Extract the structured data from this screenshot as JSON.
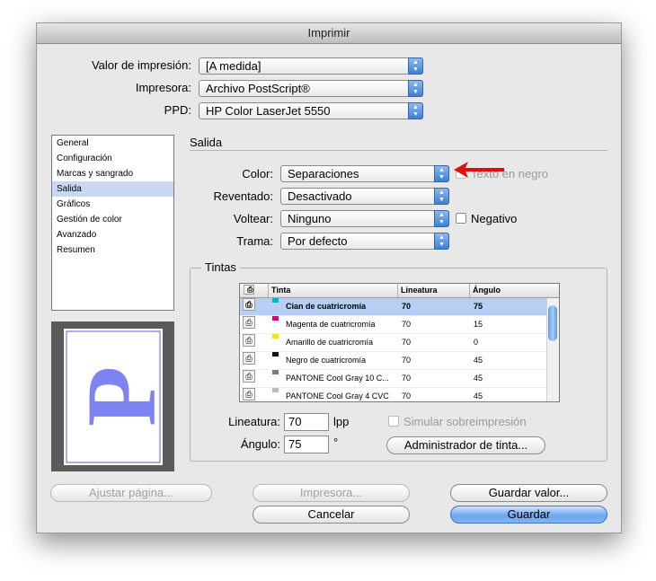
{
  "window": {
    "title": "Imprimir"
  },
  "top": {
    "preset_label": "Valor de impresión:",
    "preset_value": "[A medida]",
    "printer_label": "Impresora:",
    "printer_value": "Archivo PostScript®",
    "ppd_label": "PPD:",
    "ppd_value": "HP Color LaserJet 5550"
  },
  "sidebar": {
    "items": [
      "General",
      "Configuración",
      "Marcas y sangrado",
      "Salida",
      "Gráficos",
      "Gestión de color",
      "Avanzado",
      "Resumen"
    ],
    "selected": "Salida"
  },
  "preview": {
    "letter": "P"
  },
  "output": {
    "section_title": "Salida",
    "color_label": "Color:",
    "color_value": "Separaciones",
    "text_black_label": "Texto en negro",
    "trapping_label": "Reventado:",
    "trapping_value": "Desactivado",
    "flip_label": "Voltear:",
    "flip_value": "Ninguno",
    "negative_label": "Negativo",
    "screening_label": "Trama:",
    "screening_value": "Por defecto"
  },
  "inks": {
    "group_title": "Tintas",
    "columns": [
      "Tinta",
      "Lineatura",
      "Ángulo"
    ],
    "rows": [
      {
        "name": "Cian de cuatricromía",
        "freq": "70",
        "angle": "75",
        "swatch": "#00b7c8"
      },
      {
        "name": "Magenta de cuatricromía",
        "freq": "70",
        "angle": "15",
        "swatch": "#e2007a"
      },
      {
        "name": "Amarillo de cuatricromía",
        "freq": "70",
        "angle": "0",
        "swatch": "#f3e600"
      },
      {
        "name": "Negro de cuatricromía",
        "freq": "70",
        "angle": "45",
        "swatch": "#111111"
      },
      {
        "name": "PANTONE Cool Gray 10 C...",
        "freq": "70",
        "angle": "45",
        "swatch": "#7c7c7c"
      },
      {
        "name": "PANTONE Cool Gray 4 CVC",
        "freq": "70",
        "angle": "45",
        "swatch": "#bdbdbd"
      }
    ],
    "freq_label": "Lineatura:",
    "freq_value": "70",
    "freq_unit": "lpp",
    "angle_label": "Ángulo:",
    "angle_value": "75",
    "angle_unit": "°",
    "simulate_label": "Simular sobreimpresión",
    "ink_manager_button": "Administrador de tinta..."
  },
  "buttons": {
    "fit_page": "Ajustar página...",
    "printer": "Impresora...",
    "save_preset": "Guardar valor...",
    "cancel": "Cancelar",
    "save": "Guardar"
  },
  "colors": {
    "accent": "#3d7fd6",
    "selection": "#c7d8f2",
    "arrow": "#e01010"
  }
}
